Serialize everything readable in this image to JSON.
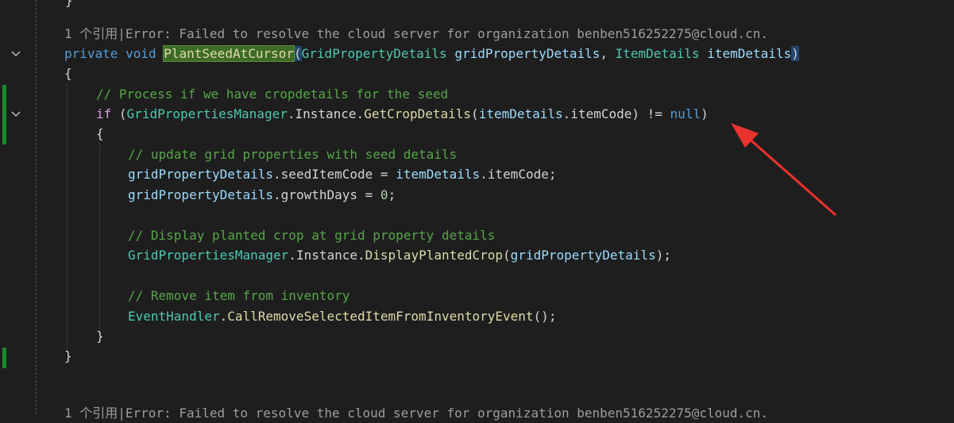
{
  "lens_top": "1 个引用|Error: Failed to resolve the cloud server for organization benben516252275@cloud.cn.",
  "lens_bottom": "1 个引用|Error: Failed to resolve the cloud server for organization benben516252275@cloud.cn.",
  "code": {
    "kw_private": "private",
    "kw_void": "void",
    "method_name": "PlantSeedAtCursor",
    "open_paren": "(",
    "close_paren": ")",
    "param1_type": "GridPropertyDetails",
    "param1_name": "gridPropertyDetails",
    "comma": ",",
    "param2_type": "ItemDetails",
    "param2_name": "itemDetails",
    "brace_open": "{",
    "brace_close": "}",
    "comment1": "// Process if we have cropdetails for the seed",
    "kw_if": "if",
    "gpm": "GridPropertiesManager",
    "dot": ".",
    "instance": "Instance",
    "get_crop_details": "GetCropDetails",
    "item_code": "itemCode",
    "neq": "!=",
    "kw_null": "null",
    "comment2": "// update grid properties with seed details",
    "seed_item_code": "seedItemCode",
    "assign": "=",
    "semi": ";",
    "growth_days": "growthDays",
    "zero": "0",
    "comment3": "// Display planted crop at grid property details",
    "display_planted_crop": "DisplayPlantedCrop",
    "comment4": "// Remove item from inventory",
    "event_handler": "EventHandler",
    "call_remove": "CallRemoveSelectedItemFromInventoryEvent",
    "empty_parens": "()"
  },
  "colors": {
    "background": "#1e1e1e",
    "keyword": "#569cd6",
    "type": "#4ec9b0",
    "method": "#dcdcaa",
    "parameter": "#9cdcfe",
    "comment": "#57a64a",
    "change_marker": "#1b8a2c",
    "arrow": "#e8322d"
  }
}
